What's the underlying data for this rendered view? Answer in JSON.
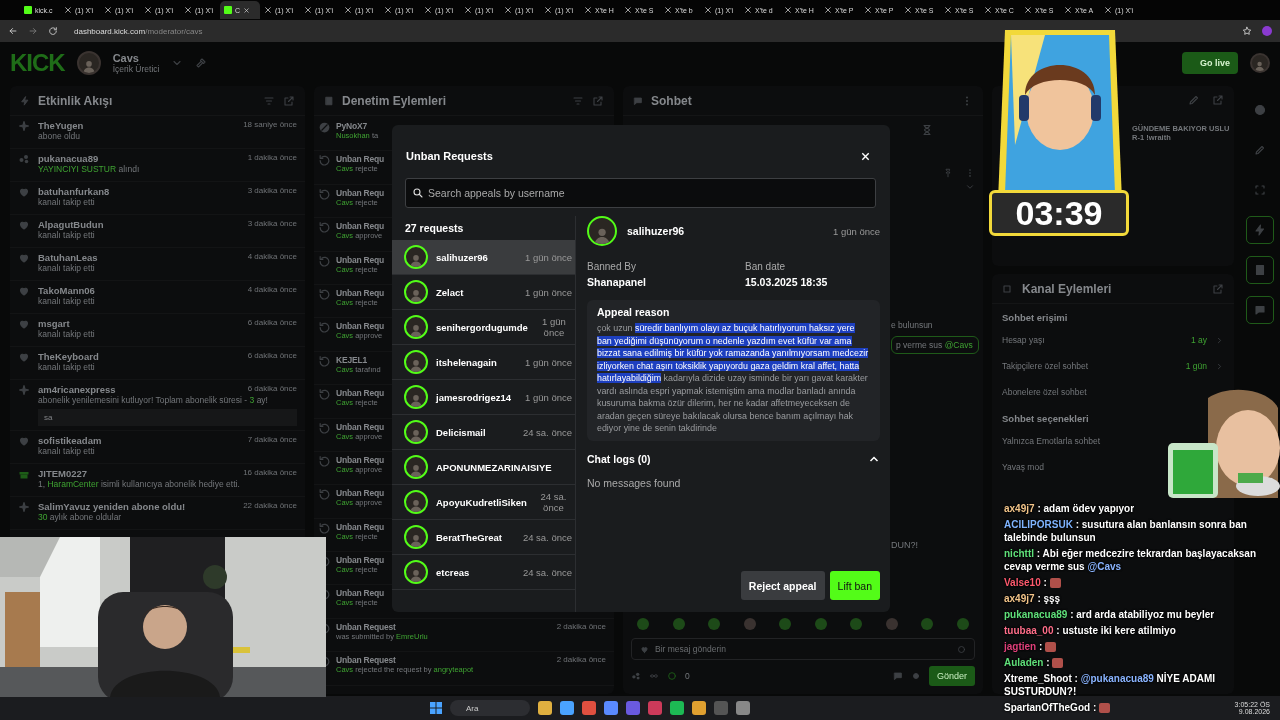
{
  "browser": {
    "tabs": [
      {
        "label": "kick.c",
        "kind": "kick",
        "selected": false
      },
      {
        "label": "(1) X'i",
        "kind": "x",
        "selected": false
      },
      {
        "label": "(1) X'i",
        "kind": "x",
        "selected": false
      },
      {
        "label": "(1) X'i",
        "kind": "x",
        "selected": false
      },
      {
        "label": "(1) X'i",
        "kind": "x",
        "selected": false
      },
      {
        "label": "C",
        "kind": "kick",
        "selected": true
      },
      {
        "label": "(1) X'i",
        "kind": "x",
        "selected": false
      },
      {
        "label": "(1) X'i",
        "kind": "x",
        "selected": false
      },
      {
        "label": "(1) X'i",
        "kind": "x",
        "selected": false
      },
      {
        "label": "(1) X'i",
        "kind": "x",
        "selected": false
      },
      {
        "label": "(1) X'i",
        "kind": "x",
        "selected": false
      },
      {
        "label": "(1) X'i",
        "kind": "x",
        "selected": false
      },
      {
        "label": "(1) X'i",
        "kind": "x",
        "selected": false
      },
      {
        "label": "(1) X'i",
        "kind": "x",
        "selected": false
      },
      {
        "label": "X'te H",
        "kind": "x",
        "selected": false
      },
      {
        "label": "X'te S",
        "kind": "x",
        "selected": false
      },
      {
        "label": "X'te b",
        "kind": "x",
        "selected": false
      },
      {
        "label": "(1) X'i",
        "kind": "x",
        "selected": false
      },
      {
        "label": "X'te d",
        "kind": "x",
        "selected": false
      },
      {
        "label": "X'te H",
        "kind": "x",
        "selected": false
      },
      {
        "label": "X'te P",
        "kind": "x",
        "selected": false
      },
      {
        "label": "X'te P",
        "kind": "x",
        "selected": false
      },
      {
        "label": "X'te S",
        "kind": "x",
        "selected": false
      },
      {
        "label": "X'te S",
        "kind": "x",
        "selected": false
      },
      {
        "label": "X'te C",
        "kind": "x",
        "selected": false
      },
      {
        "label": "X'te S",
        "kind": "x",
        "selected": false
      },
      {
        "label": "X'te A",
        "kind": "x",
        "selected": false
      },
      {
        "label": "(1) X'i",
        "kind": "x",
        "selected": false
      }
    ],
    "url_host": "dashboard.kick.com",
    "url_path": "/moderator/cavs"
  },
  "header": {
    "logo": "KICK",
    "channel": "Cavs",
    "role": "İçerik Üretici",
    "go_live": "Go live"
  },
  "activity": {
    "title": "Etkinlik Akışı",
    "items": [
      {
        "kind": "subscribe",
        "name": "TheYugen",
        "detail": [
          {
            "text": "abone oldu",
            "accent": false
          }
        ],
        "time": "18 saniye önce"
      },
      {
        "kind": "reward",
        "name": "pukanacua89",
        "detail": [
          {
            "text": "YAYINCIYI SUSTUR",
            "accent": true
          },
          {
            "text": "alındı",
            "accent": false
          }
        ],
        "time": "1 dakika önce"
      },
      {
        "kind": "follow",
        "name": "batuhanfurkan8",
        "detail": [
          {
            "text": "kanalı takip etti",
            "accent": false
          }
        ],
        "time": "3 dakika önce"
      },
      {
        "kind": "follow",
        "name": "AlpagutBudun",
        "detail": [
          {
            "text": "kanalı takip etti",
            "accent": false
          }
        ],
        "time": "3 dakika önce"
      },
      {
        "kind": "follow",
        "name": "BatuhanLeas",
        "detail": [
          {
            "text": "kanalı takip etti",
            "accent": false
          }
        ],
        "time": "4 dakika önce"
      },
      {
        "kind": "follow",
        "name": "TakoMann06",
        "detail": [
          {
            "text": "kanalı takip etti",
            "accent": false
          }
        ],
        "time": "4 dakika önce"
      },
      {
        "kind": "follow",
        "name": "msgart",
        "detail": [
          {
            "text": "kanalı takip etti",
            "accent": false
          }
        ],
        "time": "6 dakika önce"
      },
      {
        "kind": "follow",
        "name": "TheKeyboard",
        "detail": [
          {
            "text": "kanalı takip etti",
            "accent": false
          }
        ],
        "time": "6 dakika önce"
      },
      {
        "kind": "resub",
        "name": "am4ricanexpress",
        "detail": [
          {
            "text": "abonelik yenilemesini kutluyor! Toplam abonelik süresi -",
            "accent": false
          },
          {
            "text": "3",
            "accent": true
          },
          {
            "text": "ay!",
            "accent": false
          }
        ],
        "time": "6 dakika önce",
        "message": "sa"
      },
      {
        "kind": "follow",
        "name": "sofistikeadam",
        "detail": [
          {
            "text": "kanalı takip etti",
            "accent": false
          }
        ],
        "time": "7 dakika önce"
      },
      {
        "kind": "gift",
        "name": "JITEM0227",
        "detail": [
          {
            "text": "1,",
            "accent": false
          },
          {
            "text": "HaramCenter",
            "accent": true
          },
          {
            "text": "isimli kullanıcıya abonelik hediye etti.",
            "accent": false
          }
        ],
        "time": "16 dakika önce"
      },
      {
        "kind": "subscribe",
        "name": "SalimYavuz yeniden abone oldu!",
        "detail": [
          {
            "text": "30",
            "accent": true
          },
          {
            "text": "aylık abone oldular",
            "accent": false
          }
        ],
        "time": "22 dakika önce"
      }
    ]
  },
  "moderation": {
    "title": "Denetim Eylemleri",
    "items": [
      {
        "kind": "ban",
        "title": "PyNoX7",
        "detail": [
          {
            "text": "Nusokhan",
            "accent": true
          },
          {
            "text": "ta",
            "accent": false
          }
        ]
      },
      {
        "kind": "unban",
        "title": "Unban Requ",
        "detail": [
          {
            "text": "Cavs",
            "accent": true
          },
          {
            "text": "rejecte",
            "accent": false
          }
        ]
      },
      {
        "kind": "unban",
        "title": "Unban Requ",
        "detail": [
          {
            "text": "Cavs",
            "accent": true
          },
          {
            "text": "rejecte",
            "accent": false
          }
        ]
      },
      {
        "kind": "unban",
        "title": "Unban Requ",
        "detail": [
          {
            "text": "Cavs",
            "accent": true
          },
          {
            "text": "approve",
            "accent": false
          }
        ]
      },
      {
        "kind": "unban",
        "title": "Unban Requ",
        "detail": [
          {
            "text": "Cavs",
            "accent": true
          },
          {
            "text": "rejecte",
            "accent": false
          }
        ]
      },
      {
        "kind": "unban",
        "title": "Unban Requ",
        "detail": [
          {
            "text": "Cavs",
            "accent": true
          },
          {
            "text": "rejecte",
            "accent": false
          }
        ]
      },
      {
        "kind": "unban",
        "title": "Unban Requ",
        "detail": [
          {
            "text": "Cavs",
            "accent": true
          },
          {
            "text": "approve",
            "accent": false
          }
        ]
      },
      {
        "kind": "unban",
        "title": "KEJEL1",
        "detail": [
          {
            "text": "Cavs",
            "accent": true
          },
          {
            "text": "tarafınd",
            "accent": false
          }
        ]
      },
      {
        "kind": "unban",
        "title": "Unban Requ",
        "detail": [
          {
            "text": "Cavs",
            "accent": true
          },
          {
            "text": "rejecte",
            "accent": false
          }
        ]
      },
      {
        "kind": "unban",
        "title": "Unban Requ",
        "detail": [
          {
            "text": "Cavs",
            "accent": true
          },
          {
            "text": "approve",
            "accent": false
          }
        ]
      },
      {
        "kind": "unban",
        "title": "Unban Requ",
        "detail": [
          {
            "text": "Cavs",
            "accent": true
          },
          {
            "text": "approve",
            "accent": false
          }
        ]
      },
      {
        "kind": "unban",
        "title": "Unban Requ",
        "detail": [
          {
            "text": "Cavs",
            "accent": true
          },
          {
            "text": "approve",
            "accent": false
          }
        ]
      },
      {
        "kind": "unban",
        "title": "Unban Requ",
        "detail": [
          {
            "text": "Cavs",
            "accent": true
          },
          {
            "text": "rejecte",
            "accent": false
          }
        ]
      },
      {
        "kind": "unban",
        "title": "Unban Requ",
        "detail": [
          {
            "text": "Cavs",
            "accent": true
          },
          {
            "text": "rejecte",
            "accent": false
          }
        ]
      },
      {
        "kind": "unban",
        "title": "Unban Requ",
        "detail": [
          {
            "text": "Cavs",
            "accent": true
          },
          {
            "text": "rejecte",
            "accent": false
          }
        ]
      },
      {
        "kind": "unban",
        "title": "Unban Request",
        "detail": [
          {
            "text": "was submitted by",
            "accent": false
          },
          {
            "text": "EmreUrlu",
            "accent": true
          }
        ],
        "time": "2 dakika önce"
      },
      {
        "kind": "unban",
        "title": "Unban Request",
        "detail": [
          {
            "text": "Cavs",
            "accent": true
          },
          {
            "text": "rejected the request by",
            "accent": false
          },
          {
            "text": "angryteapot",
            "accent": true
          }
        ],
        "time": "2 dakika önce"
      }
    ]
  },
  "chat": {
    "title": "Sohbet",
    "fragments": [
      "e bulunsun"
    ],
    "pinned_reply": {
      "text": "p verme sus",
      "mention": "@Cavs"
    },
    "tail": "DUN?!",
    "input_placeholder": "Bir mesaj gönderin",
    "count": "0",
    "send": "Gönder"
  },
  "stream_info": [
    "GÜNDEME BAKIYOR USLU",
    "R-1 !wraith"
  ],
  "channel_actions": {
    "title": "Kanal Eylemleri",
    "sections": [
      {
        "title": "Sohbet erişimi",
        "rows": [
          {
            "label": "Hesap yaşı",
            "value": "1 ay"
          },
          {
            "label": "Takipçilere özel sohbet",
            "value": "1 gün"
          },
          {
            "label": "Abonelere özel sohbet"
          }
        ]
      },
      {
        "title": "Sohbet seçenekleri",
        "rows": [
          {
            "label": "Yalnızca Emotlarla sohbet"
          },
          {
            "label": "Yavaş mod"
          }
        ]
      }
    ]
  },
  "modal": {
    "title": "Unban Requests",
    "search_placeholder": "Search appeals by username",
    "count": "27 requests",
    "requests": [
      {
        "name": "salihuzer96",
        "time": "1 gün önce",
        "selected": true
      },
      {
        "name": "Zelact",
        "time": "1 gün önce",
        "selected": false
      },
      {
        "name": "senihergordugumde",
        "time": "1 gün önce",
        "selected": false
      },
      {
        "name": "itshelenagain",
        "time": "1 gün önce",
        "selected": false
      },
      {
        "name": "jamesrodrigez14",
        "time": "1 gün önce",
        "selected": false
      },
      {
        "name": "Delicismail",
        "time": "24 sa. önce",
        "selected": false
      },
      {
        "name": "APONUNMEZARINAISIYE",
        "selected": false
      },
      {
        "name": "ApoyuKudretliSiken",
        "time": "24 sa. önce",
        "selected": false
      },
      {
        "name": "BeratTheGreat",
        "time": "24 sa. önce",
        "selected": false
      },
      {
        "name": "etcreas",
        "time": "24 sa. önce",
        "selected": false
      }
    ],
    "detail": {
      "name": "salihuzer96",
      "time": "1 gün önce",
      "banned_by_label": "Banned By",
      "banned_by": "Shanapanel",
      "ban_date_label": "Ban date",
      "ban_date": "15.03.2025 18:35",
      "appeal_title": "Appeal reason",
      "appeal_before": "çok uzun",
      "appeal_selected": "süredir banlıyım olayı az buçuk hatırlıyorum haksız yere ban yediğimi düşünüyorum o nedenle yazdım evet küfür var ama bizzat sana edilmiş bir küfür yok ramazanda yanılmıyorsam medcezir izliyorken chat aşırı toksiklik yapıyordu gaza geldim kral affet, hatta hatırlayabildiğim",
      "appeal_after": "kadarıyla dizide uzay isminde bir yarı gavat karakter vardı aslında espri yapmak istemiştim ama modlar banladı anında kusuruma bakma özür dilerim, her ne kadar affetmeyeceksen de aradan geçen süreye bakılacak olursa bence banım açılmayı hak ediyor yine de senin takdirinde",
      "chat_logs_title": "Chat logs (0)",
      "chat_logs_expanded": true,
      "chat_logs_empty": "No messages found"
    },
    "reject": "Reject appeal",
    "lift": "Lift ban"
  },
  "stream_timer": "03:39",
  "chat_overlay": [
    {
      "name": "ax49j7",
      "color": "#f3c58a",
      "sep": ":",
      "kind": "text",
      "parts": [
        {
          "text": "adam ödev yapıyor",
          "mention": false
        }
      ]
    },
    {
      "name": "ACILIPORSUK",
      "color": "#7fb4ff",
      "sep": ":",
      "kind": "text",
      "parts": [
        {
          "text": "susutura alan banlansın sonra ban talebinde bulunsun",
          "mention": false
        }
      ]
    },
    {
      "name": "nichttl",
      "color": "#5fe07a",
      "sep": ":",
      "kind": "text",
      "parts": [
        {
          "text": "Abi eğer medcezire tekrardan başlayacaksan cevap verme sus",
          "mention": false
        },
        {
          "text": "@Cavs",
          "mention": true
        }
      ]
    },
    {
      "name": "Valse10",
      "color": "#ff5a6e",
      "sep": ":",
      "kind": "emote"
    },
    {
      "name": "ax49j7",
      "color": "#f3c58a",
      "sep": ":",
      "kind": "text",
      "parts": [
        {
          "text": "şşş",
          "mention": false
        }
      ]
    },
    {
      "name": "pukanacua89",
      "color": "#5fe07a",
      "sep": ":",
      "kind": "text",
      "parts": [
        {
          "text": "ard arda atabiliyoz mu beyler",
          "mention": false
        }
      ]
    },
    {
      "name": "tuubaa_00",
      "color": "#ff6e8a",
      "sep": ":",
      "kind": "text",
      "parts": [
        {
          "text": "ustuste iki kere atilmiyo",
          "mention": false
        }
      ]
    },
    {
      "name": "jagtien",
      "color": "#e0407a",
      "sep": ":",
      "kind": "emote"
    },
    {
      "name": "Auladen",
      "color": "#5fe07a",
      "sep": ":",
      "kind": "emote"
    },
    {
      "name": "Xtreme_Shoot",
      "color": "#ffffff",
      "sep": ":",
      "kind": "text",
      "parts": [
        {
          "text": "@pukanacua89",
          "mention": true
        },
        {
          "text": "NİYE ADAMI SUSTURDUN?!",
          "mention": false
        }
      ]
    },
    {
      "name": "SpartanOfTheGod",
      "color": "#ffffff",
      "sep": ":",
      "kind": "emote"
    }
  ],
  "taskbar": {
    "search": "Ara",
    "time": "3:05:22 ÖS",
    "date": "9.08.2026"
  }
}
